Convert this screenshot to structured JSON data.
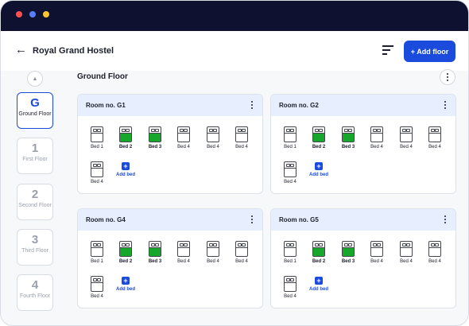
{
  "header": {
    "back_icon": "arrow-left-icon",
    "title": "Royal Grand Hostel",
    "add_floor_label": "+ Add floor"
  },
  "sidebar": {
    "floors": [
      {
        "num": "G",
        "label": "Ground Floor",
        "active": true
      },
      {
        "num": "1",
        "label": "First Floor",
        "active": false
      },
      {
        "num": "2",
        "label": "Second Floor",
        "active": false
      },
      {
        "num": "3",
        "label": "Third Floor",
        "active": false
      },
      {
        "num": "4",
        "label": "Fourth Floor",
        "active": false
      }
    ]
  },
  "main": {
    "floor_title": "Ground Floor",
    "add_bed_label": "Add bed",
    "rooms": [
      {
        "title": "Room no. G1",
        "beds": [
          {
            "label": "Bed 1",
            "occupied": false
          },
          {
            "label": "Bed 2",
            "occupied": true
          },
          {
            "label": "Bed 3",
            "occupied": true
          },
          {
            "label": "Bed 4",
            "occupied": false
          },
          {
            "label": "Bed 4",
            "occupied": false
          },
          {
            "label": "Bed 4",
            "occupied": false
          },
          {
            "label": "Bed 4",
            "occupied": false
          }
        ]
      },
      {
        "title": "Room no. G2",
        "beds": [
          {
            "label": "Bed 1",
            "occupied": false
          },
          {
            "label": "Bed 2",
            "occupied": true
          },
          {
            "label": "Bed 3",
            "occupied": true
          },
          {
            "label": "Bed 4",
            "occupied": false
          },
          {
            "label": "Bed 4",
            "occupied": false
          },
          {
            "label": "Bed 4",
            "occupied": false
          },
          {
            "label": "Bed 4",
            "occupied": false
          }
        ]
      },
      {
        "title": "Room no. G4",
        "beds": [
          {
            "label": "Bed 1",
            "occupied": false
          },
          {
            "label": "Bed 2",
            "occupied": true
          },
          {
            "label": "Bed 3",
            "occupied": true
          },
          {
            "label": "Bed 4",
            "occupied": false
          },
          {
            "label": "Bed 4",
            "occupied": false
          },
          {
            "label": "Bed 4",
            "occupied": false
          },
          {
            "label": "Bed 4",
            "occupied": false
          }
        ]
      },
      {
        "title": "Room no. G5",
        "beds": [
          {
            "label": "Bed 1",
            "occupied": false
          },
          {
            "label": "Bed 2",
            "occupied": true
          },
          {
            "label": "Bed 3",
            "occupied": true
          },
          {
            "label": "Bed 4",
            "occupied": false
          },
          {
            "label": "Bed 4",
            "occupied": false
          },
          {
            "label": "Bed 4",
            "occupied": false
          },
          {
            "label": "Bed 4",
            "occupied": false
          }
        ]
      }
    ]
  },
  "colors": {
    "accent": "#1a4bdc",
    "occupied": "#16a72b",
    "room_header": "#e7efff",
    "titlebar": "#0e1230"
  }
}
